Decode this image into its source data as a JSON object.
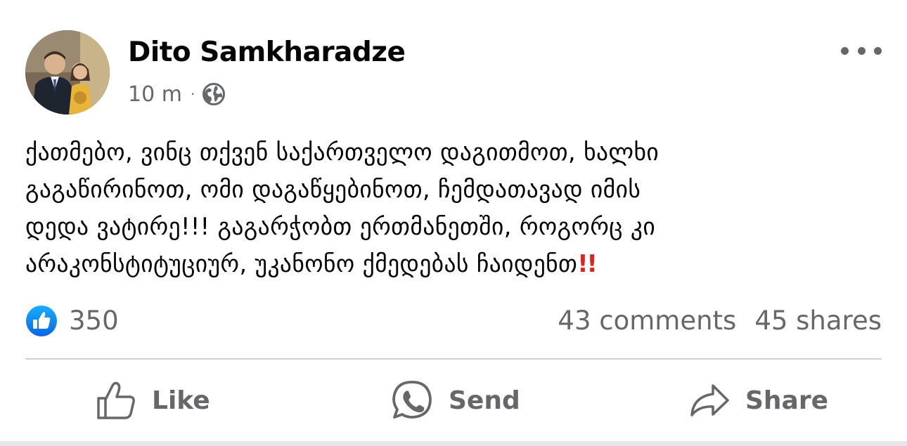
{
  "post": {
    "author": "Dito Samkharadze",
    "time": "10 m",
    "separator": "·",
    "audience_icon": "globe-icon",
    "more_icon": "more-options-icon",
    "text": "ქათმებო, ვინც თქვენ საქართველო დაგითმოთ, ხალხი\nგაგაწირინოთ, ომი დაგაწყებინოთ, ჩემდათავად იმის\nდედა ვატირე!!! გაგარჭობთ ერთმანეთში, როგორც კი\nარაკონსტიტუციურ, უკანონო ქმედებას ჩაიდენთ",
    "text_emoji": "!!",
    "text_emoji_color": "#e0241b"
  },
  "stats": {
    "reaction_icon": "like-reaction-icon",
    "reaction_count": "350",
    "comments": "43 comments",
    "shares": "45 shares"
  },
  "actions": {
    "like": "Like",
    "send": "Send",
    "share": "Share"
  },
  "colors": {
    "text_primary": "#050505",
    "text_secondary": "#65676b",
    "like_blue": "#1877f2",
    "divider": "#ced0d4"
  }
}
